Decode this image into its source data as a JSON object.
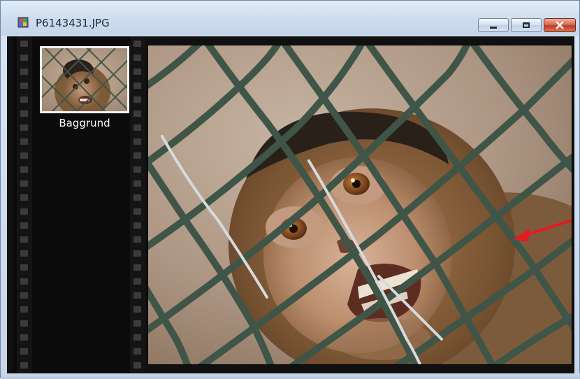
{
  "window": {
    "title": "P6143431.JPG",
    "app_icon": "image-file-icon",
    "controls": {
      "minimize_icon": "minimize-icon",
      "maximize_icon": "maximize-icon",
      "close_icon": "close-icon",
      "close_color": "#c8412a"
    }
  },
  "filmstrip": {
    "items": [
      {
        "label": "Baggrund",
        "selected": true
      }
    ]
  },
  "canvas": {
    "image_subject": "monkey-behind-chain-link-fence",
    "annotation_arrow_color": "#e11d1d"
  }
}
